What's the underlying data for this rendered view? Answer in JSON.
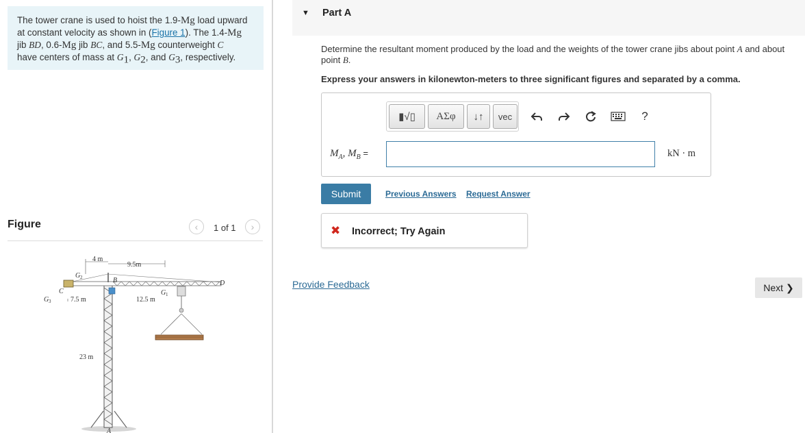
{
  "problem": {
    "text_1": "The tower crane is used to hoist the 1.9-",
    "unit_mg": "Mg",
    "text_2": " load upward at constant velocity as shown in (",
    "figure_link": "Figure 1",
    "text_3": "). The 1.4-",
    "text_4": " jib ",
    "jib1": "BD",
    "text_5": ", 0.6-",
    "text_6": " jib ",
    "jib2": "BC",
    "text_7": ", and 5.5-",
    "text_8": " counterweight ",
    "cw": "C",
    "text_9": " have centers of mass at ",
    "g1": "G",
    "g1_sub": "1",
    "g2": "G",
    "g2_sub": "2",
    "g3": "G",
    "g3_sub": "3",
    "text_10": ", respectively.",
    "comma": ", ",
    "and": ", and "
  },
  "figure": {
    "heading": "Figure",
    "pager": "1 of 1",
    "labels": {
      "dim_4m": "4 m",
      "dim_9_5m": "9.5m",
      "dim_7_5m": "7.5 m",
      "dim_12_5m": "12.5 m",
      "dim_23m": "23 m",
      "pt_B": "B",
      "pt_C": "C",
      "pt_D": "D",
      "pt_A": "A",
      "pt_G1": "G",
      "pt_G2": "G",
      "pt_G3": "G",
      "sub_1": "1",
      "sub_2": "2",
      "sub_3": "3"
    }
  },
  "part": {
    "title": "Part A",
    "question_1": "Determine the resultant moment produced by the load and the weights of the tower crane jibs about point ",
    "point_a": "A",
    "question_2": " and about point ",
    "point_b": "B",
    "question_3": ".",
    "instructions": "Express your answers in kilonewton-meters to three significant figures and separated by a comma."
  },
  "toolbar": {
    "templates_label": "▮√▯",
    "symbols_label": "ΑΣφ",
    "arrows_label": "↓↑",
    "vec_label": "vec",
    "help_label": "?"
  },
  "answer": {
    "label_m": "M",
    "label_a": "A",
    "label_sep": ", ",
    "label_b": "B",
    "label_eq": " =",
    "value": "",
    "units": "kN · m"
  },
  "actions": {
    "submit": "Submit",
    "previous_answers": "Previous Answers",
    "request_answer": "Request Answer"
  },
  "feedback": {
    "icon": "✖",
    "text": "Incorrect; Try Again"
  },
  "footer": {
    "provide_feedback": "Provide Feedback",
    "next": "Next"
  },
  "colors": {
    "accent": "#3a7ca5",
    "problem_bg": "#e8f4f8",
    "error": "#d0271d"
  }
}
